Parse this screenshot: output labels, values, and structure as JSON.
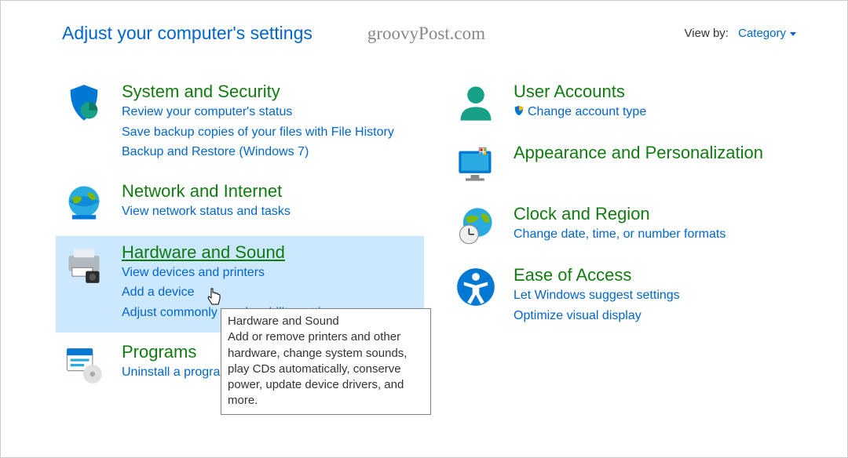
{
  "header": {
    "title": "Adjust your computer's settings",
    "watermark": "groovyPost.com",
    "viewby_label": "View by:",
    "viewby_value": "Category"
  },
  "left": [
    {
      "title": "System and Security",
      "links": [
        "Review your computer's status",
        "Save backup copies of your files with File History",
        "Backup and Restore (Windows 7)"
      ]
    },
    {
      "title": "Network and Internet",
      "links": [
        "View network status and tasks"
      ]
    },
    {
      "title": "Hardware and Sound",
      "links": [
        "View devices and printers",
        "Add a device",
        "Adjust commonly used mobility settings"
      ],
      "highlight": true
    },
    {
      "title": "Programs",
      "links": [
        "Uninstall a program"
      ]
    }
  ],
  "right": [
    {
      "title": "User Accounts",
      "links": [
        "Change account type"
      ],
      "shield_on_first": true
    },
    {
      "title": "Appearance and Personalization",
      "links": []
    },
    {
      "title": "Clock and Region",
      "links": [
        "Change date, time, or number formats"
      ]
    },
    {
      "title": "Ease of Access",
      "links": [
        "Let Windows suggest settings",
        "Optimize visual display"
      ]
    }
  ],
  "tooltip": {
    "title": "Hardware and Sound",
    "body": "Add or remove printers and other hardware, change system sounds, play CDs automatically, conserve power, update device drivers, and more."
  }
}
